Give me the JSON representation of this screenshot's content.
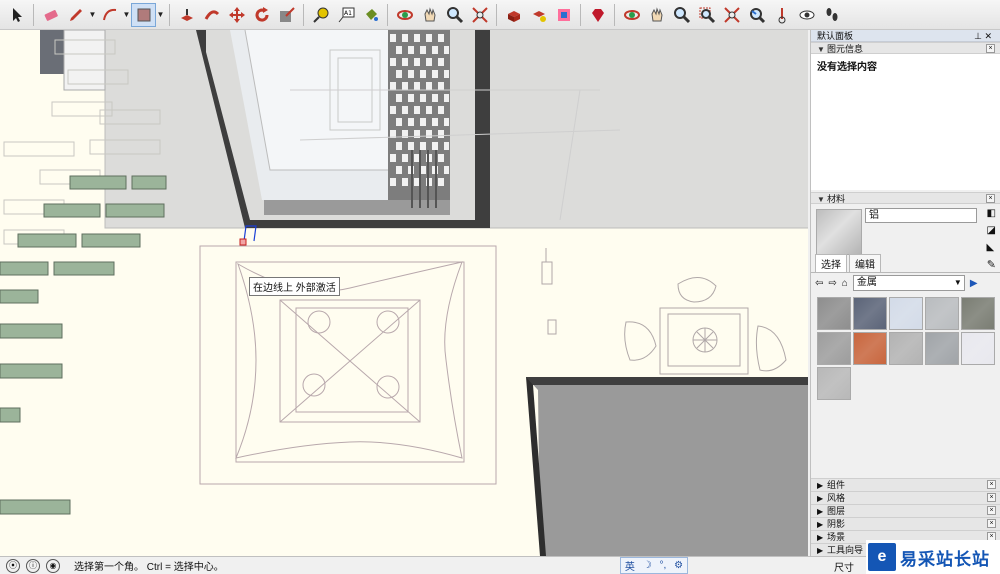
{
  "toolbar": {
    "icons": [
      "select-icon",
      "eraser-icon",
      "pencil-icon",
      "arc-icon",
      "rectangle-icon",
      "push-pull-icon",
      "follow-me-icon",
      "move-icon",
      "rotate-icon",
      "scale-icon",
      "tape-measure-icon",
      "text-icon",
      "paint-bucket-icon",
      "orbit-icon",
      "pan-icon",
      "zoom-icon",
      "zoom-extents-icon",
      "component-icon",
      "component-options-icon",
      "section-icon",
      "ruby-icon",
      "orbit2-icon",
      "pan2-icon",
      "zoom2-icon",
      "zoom-window-icon",
      "zoom-extents2-icon",
      "previous-view-icon",
      "position-camera-icon",
      "look-around-icon",
      "walk-icon"
    ]
  },
  "viewport": {
    "tooltip": "在边线上 外部激活"
  },
  "panel": {
    "tray_title": "默认面板",
    "entity_info": {
      "title": "图元信息",
      "body": "没有选择内容"
    },
    "materials": {
      "title": "材料",
      "name": "铝",
      "tab_select": "选择",
      "tab_edit": "编辑",
      "library": "金属",
      "swatches": [
        "#8e8e8e",
        "#5b6478",
        "#d3dbe8",
        "#b9bcbf",
        "#7a7d73",
        "#9d9d9d",
        "#c8663e",
        "#b3b3b3",
        "#a0a4a8",
        "#e8e8ee",
        "#b8b8b8"
      ]
    },
    "collapsed_sections": [
      "组件",
      "风格",
      "图层",
      "阴影",
      "场景",
      "工具向导"
    ]
  },
  "statusbar": {
    "text": "选择第一个角。 Ctrl = 选择中心。",
    "ime": [
      "英",
      "☽",
      "°,",
      "⚙"
    ],
    "dimension_label": "尺寸"
  },
  "watermark": {
    "logo": "e",
    "text": "易采站长站"
  }
}
